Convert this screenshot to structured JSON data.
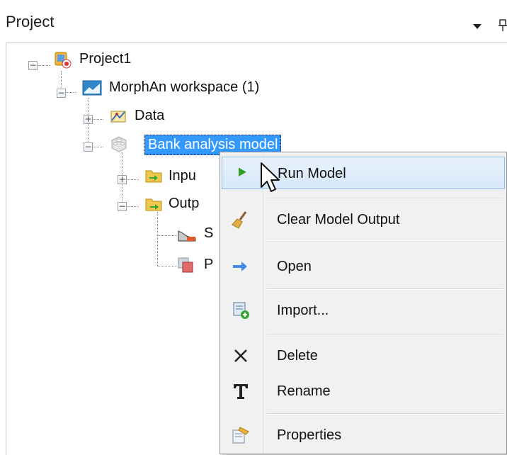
{
  "panel": {
    "title": "Project"
  },
  "tree": {
    "project": "Project1",
    "workspace": "MorphAn workspace (1)",
    "data": "Data",
    "model": "Bank analysis model",
    "input": "Inpu",
    "output": "Outp",
    "child1": "S",
    "child2": "P"
  },
  "context_menu": {
    "run_model": "Run Model",
    "clear_output": "Clear Model Output",
    "open": "Open",
    "import": "Import...",
    "delete": "Delete",
    "rename": "Rename",
    "properties": "Properties"
  },
  "colors": {
    "selection": "#3399ff",
    "menu_hover": "#d6e8fa",
    "run_arrow": "#2e9e24"
  },
  "icons": [
    "dropdown-arrow-icon",
    "pin-icon",
    "project-icon",
    "workspace-icon",
    "data-icon",
    "model-icon",
    "input-folder-icon",
    "output-folder-icon",
    "run-icon",
    "broom-icon",
    "open-arrow-icon",
    "import-icon",
    "delete-icon",
    "rename-icon",
    "properties-icon",
    "mouse-cursor-icon"
  ]
}
